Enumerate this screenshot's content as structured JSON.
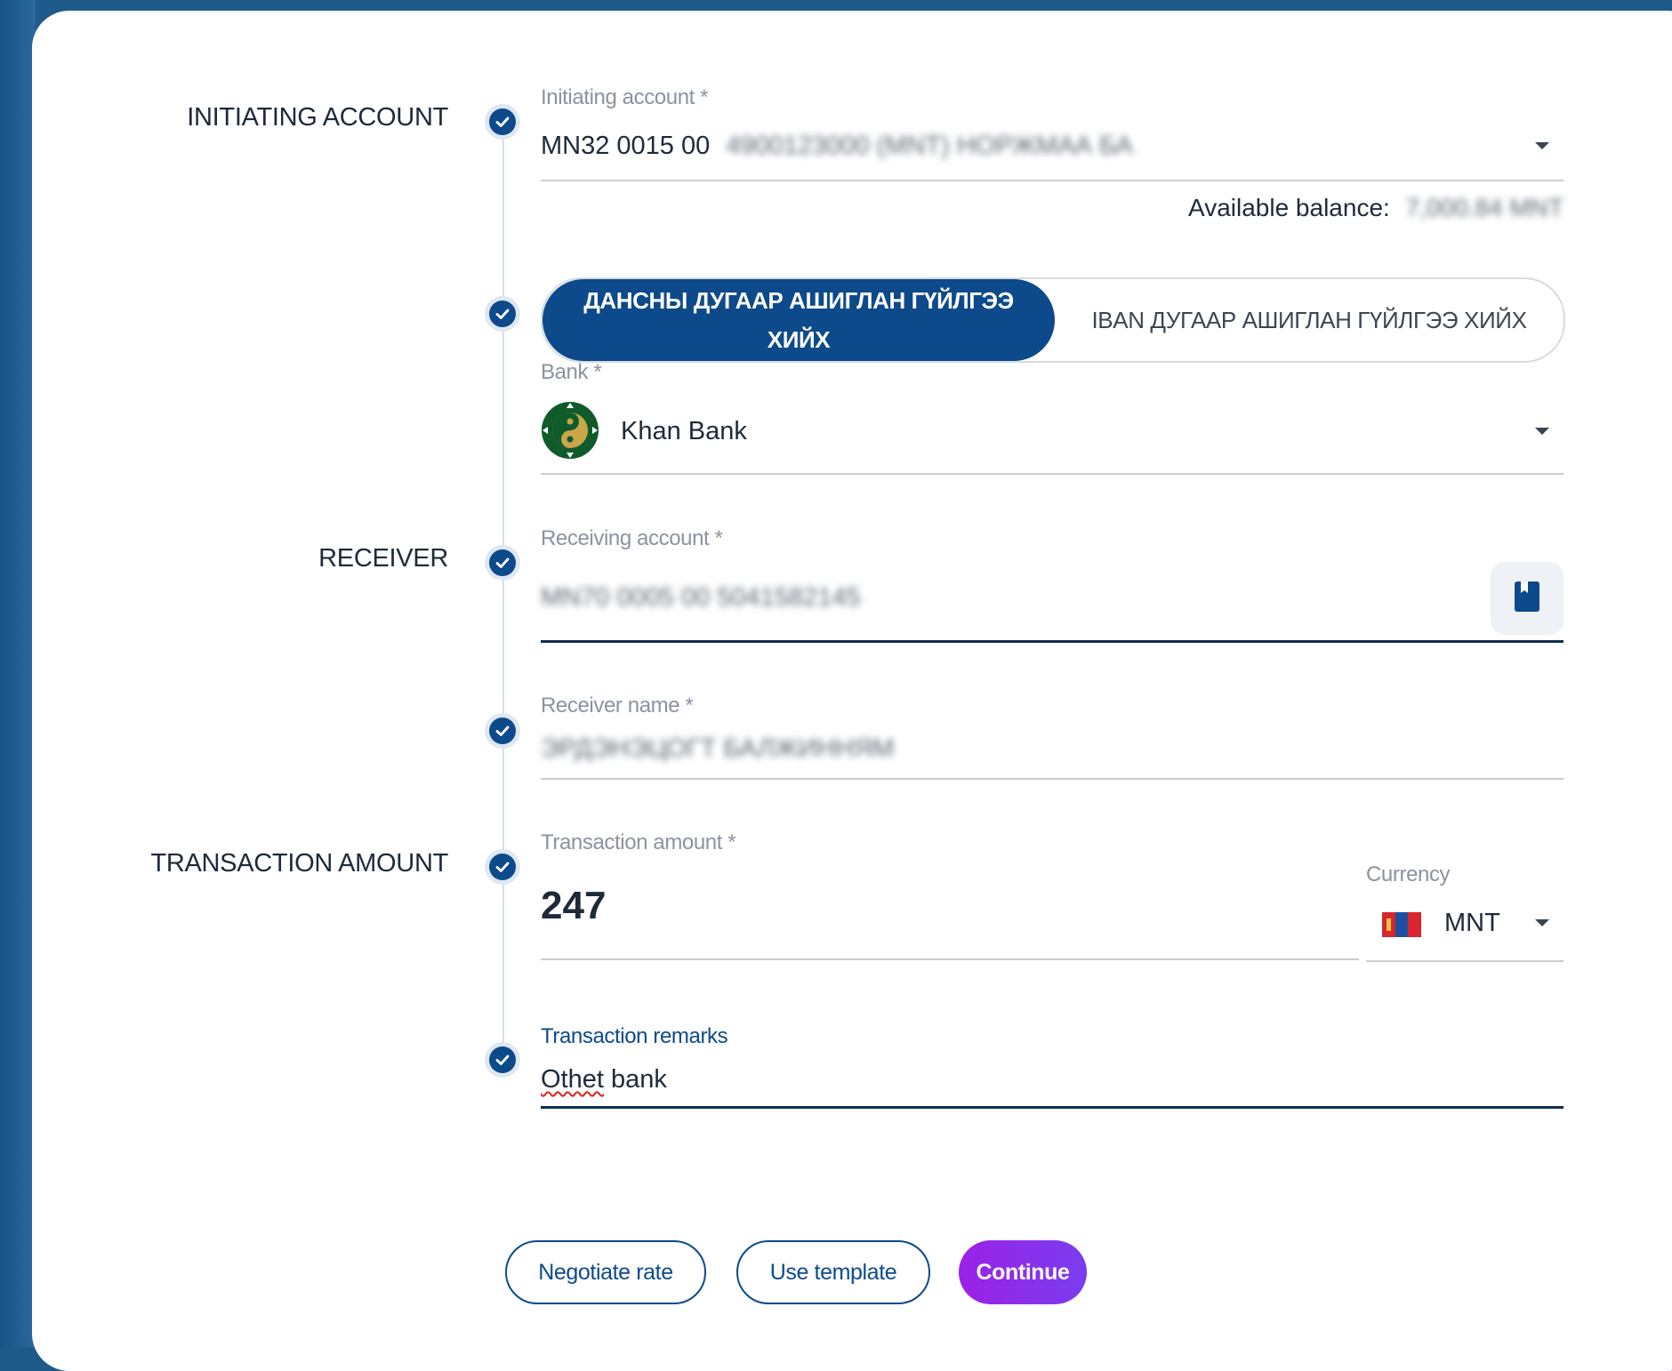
{
  "sections": {
    "initiating": "INITIATING ACCOUNT",
    "receiver": "RECEIVER",
    "amount": "TRANSACTION AMOUNT"
  },
  "initiating_account": {
    "label": "Initiating account *",
    "value_visible": "MN32 0015 00",
    "value_hidden": "4900123000 (MNT) НОРЖМАА БА",
    "balance_label": "Available balance:",
    "balance_hidden": "7,000.84 MNT"
  },
  "transfer_type": {
    "active": "ДАНСНЫ ДУГААР АШИГЛАН ГҮЙЛГЭЭ ХИЙХ",
    "inactive": "IBAN ДУГААР АШИГЛАН ГҮЙЛГЭЭ ХИЙХ"
  },
  "bank": {
    "label": "Bank *",
    "value": "Khan Bank"
  },
  "receiving_account": {
    "label": "Receiving account *",
    "value_hidden": "MN70 0005 00  5041582145"
  },
  "receiver_name": {
    "label": "Receiver name *",
    "value_hidden": "ЭРДЭНЭЦОГТ БАЛЖИННЯМ"
  },
  "transaction_amount": {
    "label": "Transaction amount *",
    "value": "247",
    "currency_label": "Currency",
    "currency": "MNT"
  },
  "remarks": {
    "label": "Transaction remarks",
    "value_a": "Othet",
    "value_b": " bank"
  },
  "buttons": {
    "negotiate": "Negotiate rate",
    "template": "Use template",
    "continue": "Continue"
  },
  "colors": {
    "primary": "#0d4a8b",
    "accent_start": "#9b21e6",
    "accent_end": "#7a3df0",
    "background": "#1e5a8a"
  }
}
